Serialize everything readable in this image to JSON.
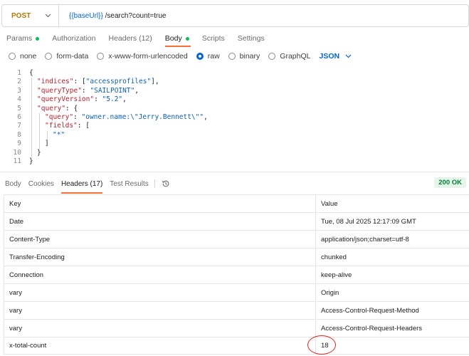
{
  "request": {
    "method": "POST",
    "url_variable": "{{baseUrl}}",
    "url_path": " /search?count=true"
  },
  "request_tabs": [
    {
      "label": "Params",
      "dot": true
    },
    {
      "label": "Authorization",
      "dot": false
    },
    {
      "label": "Headers (12)",
      "dot": false
    },
    {
      "label": "Body",
      "dot": true,
      "active": true
    },
    {
      "label": "Scripts",
      "dot": false
    },
    {
      "label": "Settings",
      "dot": false
    }
  ],
  "body_types": [
    {
      "label": "none",
      "selected": false
    },
    {
      "label": "form-data",
      "selected": false
    },
    {
      "label": "x-www-form-urlencoded",
      "selected": false
    },
    {
      "label": "raw",
      "selected": true
    },
    {
      "label": "binary",
      "selected": false
    },
    {
      "label": "GraphQL",
      "selected": false
    }
  ],
  "body_language": "JSON",
  "code_lines": [
    {
      "n": "1",
      "indent": 0,
      "parts": [
        [
          "p",
          "{"
        ]
      ]
    },
    {
      "n": "2",
      "indent": 1,
      "parts": [
        [
          "k",
          "\"indices\""
        ],
        [
          "p",
          ": ["
        ],
        [
          "s",
          "\"accessprofiles\""
        ],
        [
          "p",
          "],"
        ]
      ]
    },
    {
      "n": "3",
      "indent": 1,
      "parts": [
        [
          "k",
          "\"queryType\""
        ],
        [
          "p",
          ": "
        ],
        [
          "s",
          "\"SAILPOINT\""
        ],
        [
          "p",
          ","
        ]
      ]
    },
    {
      "n": "4",
      "indent": 1,
      "parts": [
        [
          "k",
          "\"queryVersion\""
        ],
        [
          "p",
          ": "
        ],
        [
          "s",
          "\"5.2\""
        ],
        [
          "p",
          ","
        ]
      ]
    },
    {
      "n": "5",
      "indent": 1,
      "parts": [
        [
          "k",
          "\"query\""
        ],
        [
          "p",
          ": {"
        ]
      ]
    },
    {
      "n": "6",
      "indent": 2,
      "parts": [
        [
          "k",
          "\"query\""
        ],
        [
          "p",
          ": "
        ],
        [
          "s",
          "\"owner.name:\\\"Jerry.Bennett\\\"\""
        ],
        [
          "p",
          ","
        ]
      ]
    },
    {
      "n": "7",
      "indent": 2,
      "parts": [
        [
          "k",
          "\"fields\""
        ],
        [
          "p",
          ": ["
        ]
      ]
    },
    {
      "n": "8",
      "indent": 3,
      "parts": [
        [
          "s",
          "\"*\""
        ]
      ]
    },
    {
      "n": "9",
      "indent": 2,
      "parts": [
        [
          "p",
          "]"
        ]
      ]
    },
    {
      "n": "10",
      "indent": 1,
      "parts": [
        [
          "p",
          "}"
        ]
      ]
    },
    {
      "n": "11",
      "indent": 0,
      "parts": [
        [
          "p",
          "}"
        ]
      ]
    }
  ],
  "response_tabs": [
    {
      "label": "Body",
      "active": false
    },
    {
      "label": "Cookies",
      "active": false
    },
    {
      "label": "Headers (17)",
      "active": true
    },
    {
      "label": "Test Results",
      "active": false
    }
  ],
  "status": "200 OK",
  "headers_table": {
    "columns": [
      "Key",
      "Value"
    ],
    "rows": [
      [
        "Date",
        "Tue, 08 Jul 2025 12:17:09 GMT"
      ],
      [
        "Content-Type",
        "application/json;charset=utf-8"
      ],
      [
        "Transfer-Encoding",
        "chunked"
      ],
      [
        "Connection",
        "keep-alive"
      ],
      [
        "vary",
        "Origin"
      ],
      [
        "vary",
        "Access-Control-Request-Method"
      ],
      [
        "vary",
        "Access-Control-Request-Headers"
      ],
      [
        "x-total-count",
        "18"
      ]
    ]
  },
  "colors": {
    "method": "#ad7a03",
    "variable": "#0265d2",
    "accent": "#ff6c37",
    "dot": "#0cbb52",
    "json_key": "#b5212d",
    "json_string": "#0a5fb4",
    "status_text": "#007f31",
    "annotation": "#e02020"
  },
  "icons": {
    "method_dropdown": "chevron-down-icon",
    "language_dropdown": "chevron-down-icon",
    "history": "history-icon"
  }
}
